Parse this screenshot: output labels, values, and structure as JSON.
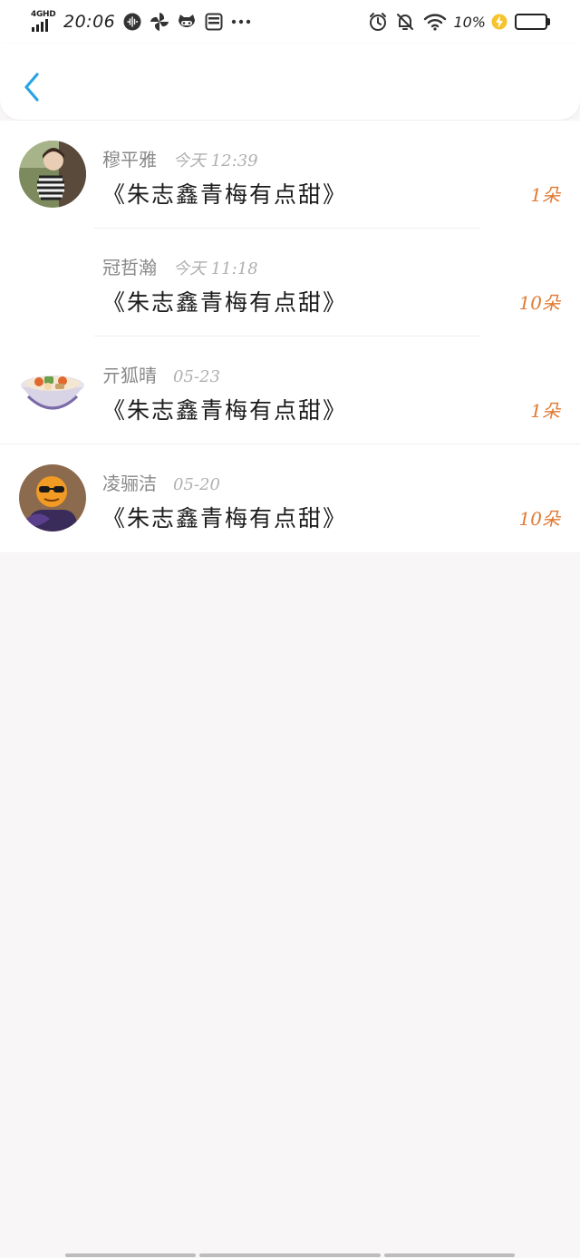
{
  "status_bar": {
    "network": "4GHD",
    "time": "20:06",
    "battery_percent": "10%"
  },
  "header": {
    "back_icon": "chevron-left-icon",
    "accent_color": "#2aa3e6"
  },
  "gifts": [
    {
      "name": "穆平雅",
      "time": "今天 12:39",
      "title": "《朱志鑫青梅有点甜》",
      "amount": "1朵",
      "avatar": "photo-avatar"
    },
    {
      "name": "冠哲瀚",
      "time": "今天 11:18",
      "title": "《朱志鑫青梅有点甜》",
      "amount": "10朵",
      "avatar": ""
    },
    {
      "name": "亓狐晴",
      "time": "05-23",
      "title": "《朱志鑫青梅有点甜》",
      "amount": "1朵",
      "avatar": "bowl-avatar"
    },
    {
      "name": "凌骊洁",
      "time": "05-20",
      "title": "《朱志鑫青梅有点甜》",
      "amount": "10朵",
      "avatar": "orange-character-avatar"
    }
  ],
  "colors": {
    "amount": "#e07a32",
    "name": "#888888",
    "background": "#f8f6f7"
  }
}
